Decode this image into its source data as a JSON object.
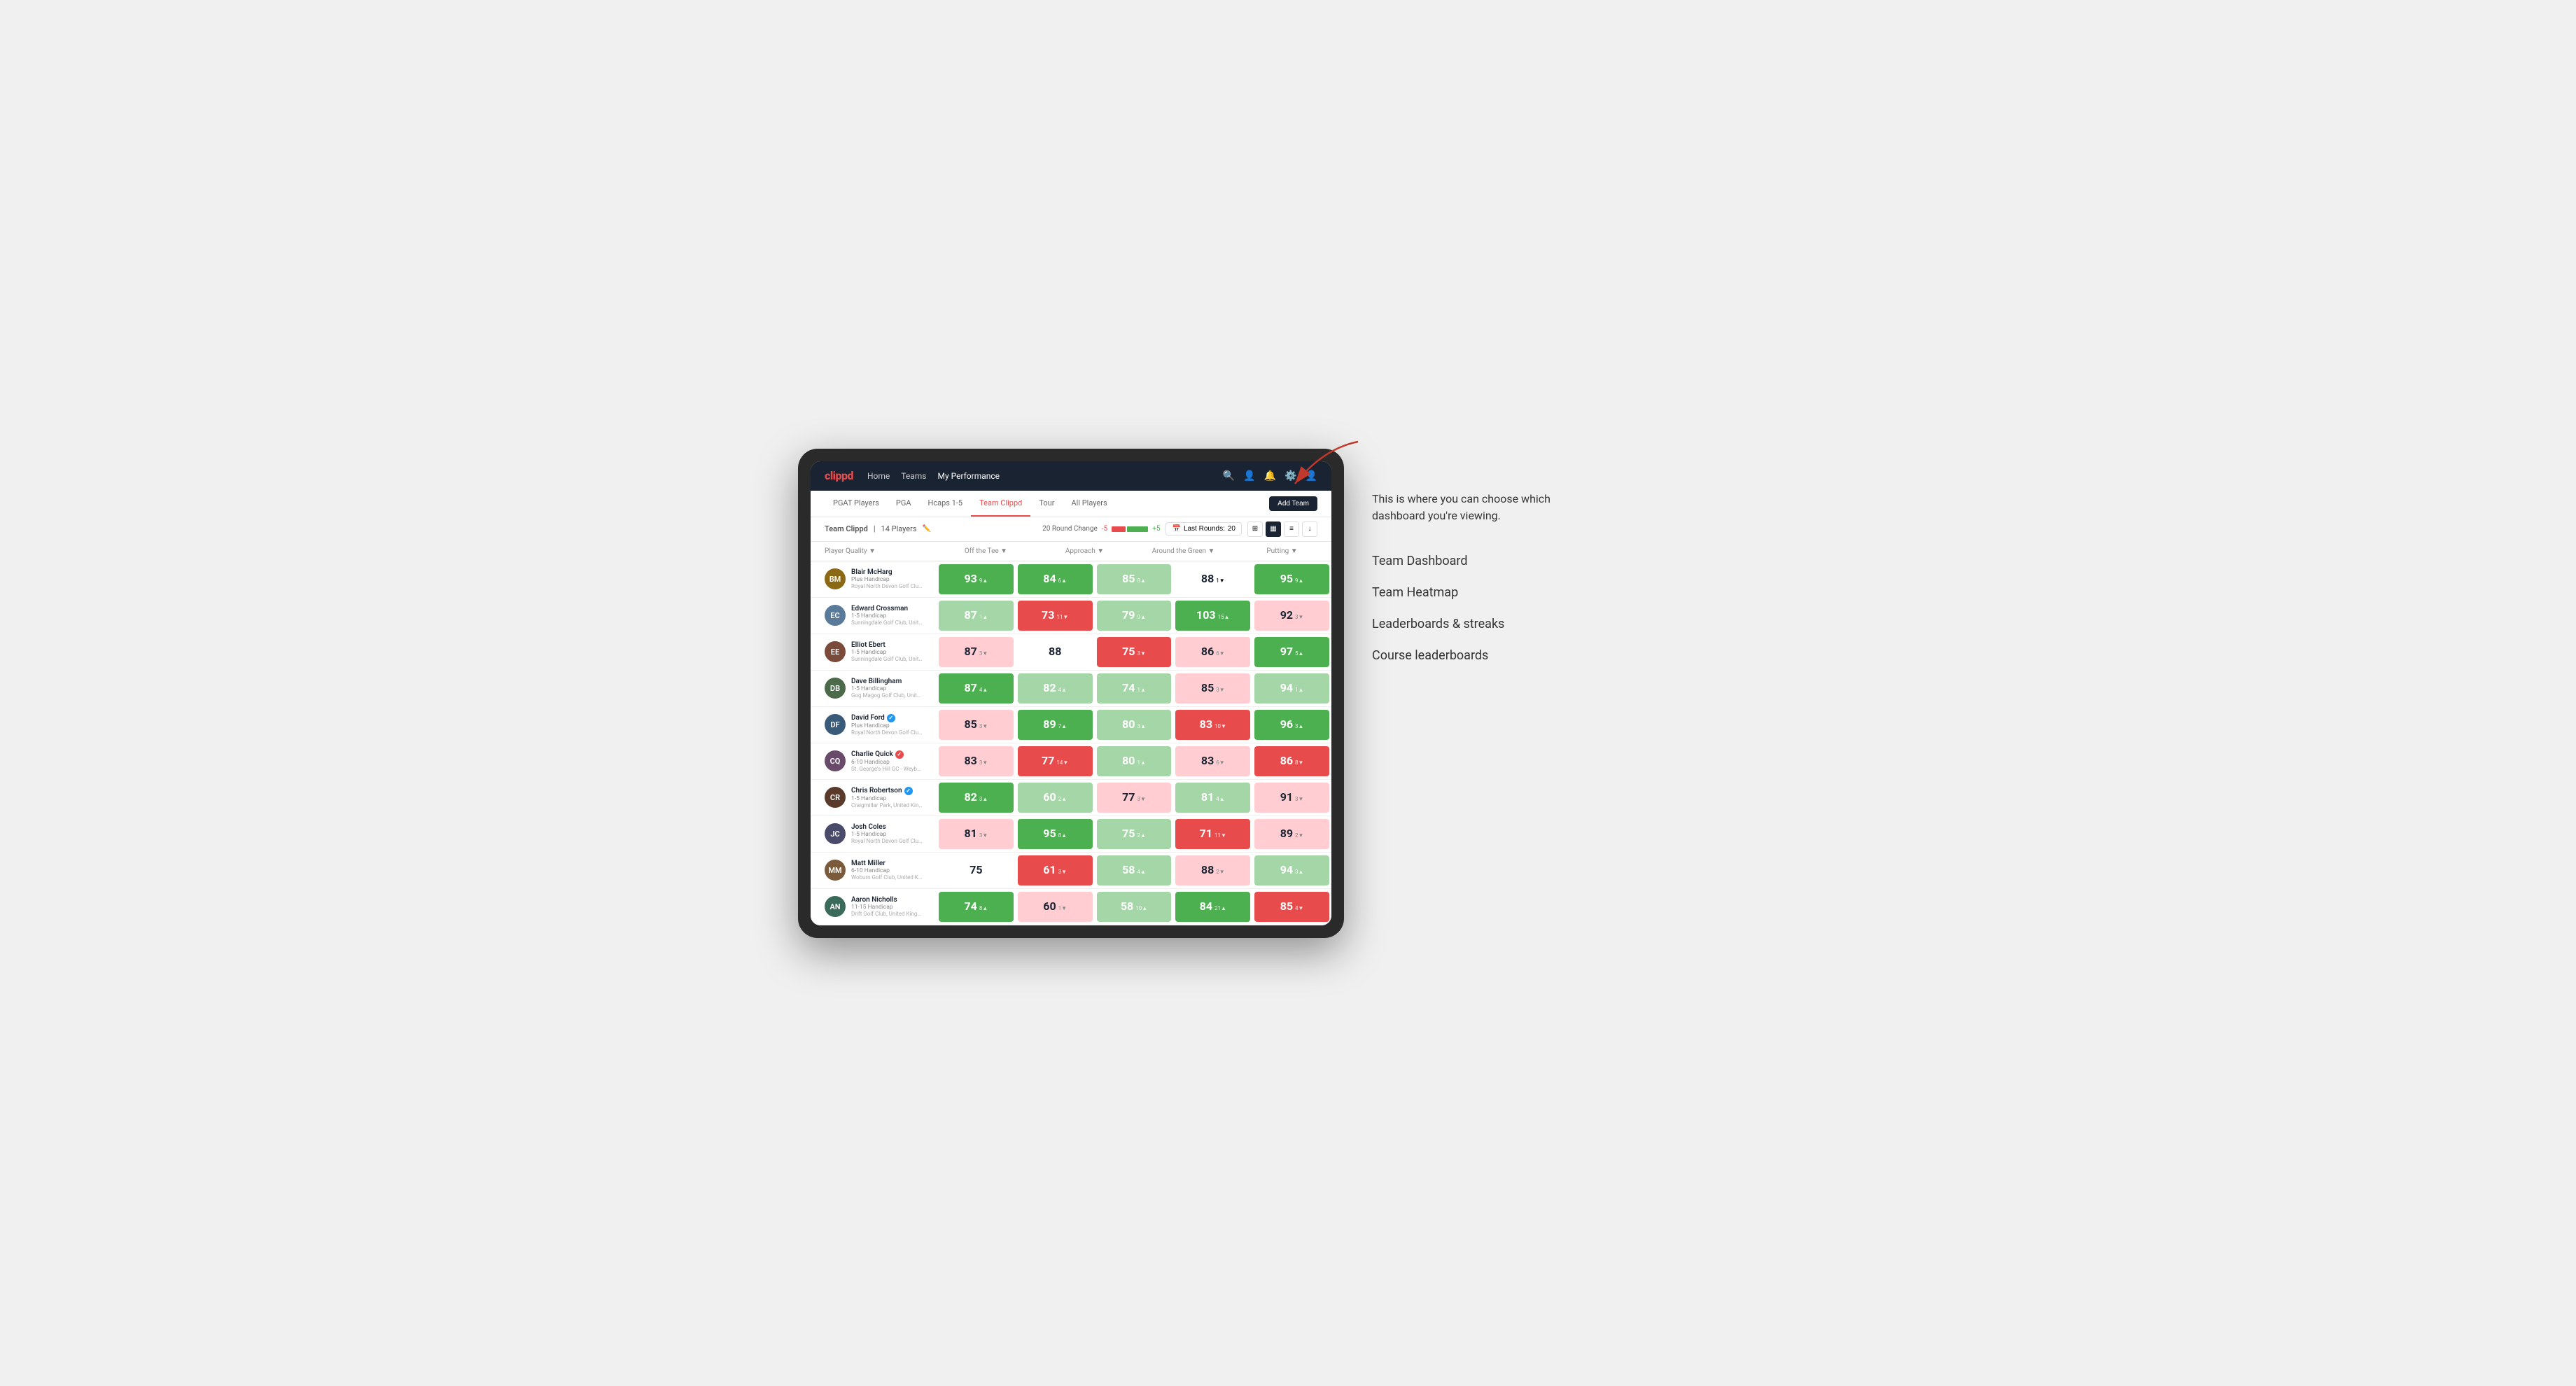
{
  "annotation": {
    "description": "This is where you can choose which dashboard you're viewing.",
    "items": [
      "Team Dashboard",
      "Team Heatmap",
      "Leaderboards & streaks",
      "Course leaderboards"
    ]
  },
  "nav": {
    "logo": "clippd",
    "links": [
      "Home",
      "Teams",
      "My Performance"
    ],
    "active_link": "My Performance"
  },
  "sub_nav": {
    "items": [
      "PGAT Players",
      "PGA",
      "Hcaps 1-5",
      "Team Clippd",
      "Tour",
      "All Players"
    ],
    "active_item": "Team Clippd",
    "add_team_label": "Add Team"
  },
  "team_header": {
    "title": "Team Clippd",
    "player_count": "14 Players",
    "round_change_label": "20 Round Change",
    "minus_label": "-5",
    "plus_label": "+5",
    "last_rounds_label": "Last Rounds:",
    "last_rounds_value": "20"
  },
  "columns": {
    "player_quality": "Player Quality ▼",
    "off_tee": "Off the Tee ▼",
    "approach": "Approach ▼",
    "around_green": "Around the Green ▼",
    "putting": "Putting ▼"
  },
  "players": [
    {
      "name": "Blair McHarg",
      "handicap": "Plus Handicap",
      "club": "Royal North Devon Golf Club, United Kingdom",
      "avatar_color": "#8B6914",
      "initials": "BM",
      "stats": {
        "player_quality": {
          "value": "93",
          "change": "9▲",
          "color": "green"
        },
        "off_tee": {
          "value": "84",
          "change": "6▲",
          "color": "green"
        },
        "approach": {
          "value": "85",
          "change": "8▲",
          "color": "light-green"
        },
        "around_green": {
          "value": "88",
          "change": "1▼",
          "color": "white"
        },
        "putting": {
          "value": "95",
          "change": "9▲",
          "color": "green"
        }
      }
    },
    {
      "name": "Edward Crossman",
      "handicap": "1-5 Handicap",
      "club": "Sunningdale Golf Club, United Kingdom",
      "avatar_color": "#5a7a9a",
      "initials": "EC",
      "stats": {
        "player_quality": {
          "value": "87",
          "change": "1▲",
          "color": "light-green"
        },
        "off_tee": {
          "value": "73",
          "change": "11▼",
          "color": "red"
        },
        "approach": {
          "value": "79",
          "change": "9▲",
          "color": "light-green"
        },
        "around_green": {
          "value": "103",
          "change": "15▲",
          "color": "green"
        },
        "putting": {
          "value": "92",
          "change": "3▼",
          "color": "light-red"
        }
      }
    },
    {
      "name": "Elliot Ebert",
      "handicap": "1-5 Handicap",
      "club": "Sunningdale Golf Club, United Kingdom",
      "avatar_color": "#7a4a3a",
      "initials": "EE",
      "stats": {
        "player_quality": {
          "value": "87",
          "change": "3▼",
          "color": "light-red"
        },
        "off_tee": {
          "value": "88",
          "change": "",
          "color": "white"
        },
        "approach": {
          "value": "75",
          "change": "3▼",
          "color": "red"
        },
        "around_green": {
          "value": "86",
          "change": "6▼",
          "color": "light-red"
        },
        "putting": {
          "value": "97",
          "change": "5▲",
          "color": "green"
        }
      }
    },
    {
      "name": "Dave Billingham",
      "handicap": "1-5 Handicap",
      "club": "Gog Magog Golf Club, United Kingdom",
      "avatar_color": "#4a6a4a",
      "initials": "DB",
      "stats": {
        "player_quality": {
          "value": "87",
          "change": "4▲",
          "color": "green"
        },
        "off_tee": {
          "value": "82",
          "change": "4▲",
          "color": "light-green"
        },
        "approach": {
          "value": "74",
          "change": "1▲",
          "color": "light-green"
        },
        "around_green": {
          "value": "85",
          "change": "3▼",
          "color": "light-red"
        },
        "putting": {
          "value": "94",
          "change": "1▲",
          "color": "light-green"
        }
      }
    },
    {
      "name": "David Ford",
      "handicap": "Plus Handicap",
      "club": "Royal North Devon Golf Club, United Kingdom",
      "avatar_color": "#3a5a7a",
      "initials": "DF",
      "badge": true,
      "badge_type": "blue",
      "stats": {
        "player_quality": {
          "value": "85",
          "change": "3▼",
          "color": "light-red"
        },
        "off_tee": {
          "value": "89",
          "change": "7▲",
          "color": "green"
        },
        "approach": {
          "value": "80",
          "change": "3▲",
          "color": "light-green"
        },
        "around_green": {
          "value": "83",
          "change": "10▼",
          "color": "red"
        },
        "putting": {
          "value": "96",
          "change": "3▲",
          "color": "green"
        }
      }
    },
    {
      "name": "Charlie Quick",
      "handicap": "6-10 Handicap",
      "club": "St. George's Hill GC - Weybridge - Surrey, Uni...",
      "avatar_color": "#6a4a6a",
      "initials": "CQ",
      "badge": true,
      "badge_type": "red",
      "stats": {
        "player_quality": {
          "value": "83",
          "change": "3▼",
          "color": "light-red"
        },
        "off_tee": {
          "value": "77",
          "change": "14▼",
          "color": "red"
        },
        "approach": {
          "value": "80",
          "change": "1▲",
          "color": "light-green"
        },
        "around_green": {
          "value": "83",
          "change": "6▼",
          "color": "light-red"
        },
        "putting": {
          "value": "86",
          "change": "8▼",
          "color": "red"
        }
      }
    },
    {
      "name": "Chris Robertson",
      "handicap": "1-5 Handicap",
      "club": "Craigmillar Park, United Kingdom",
      "avatar_color": "#5a3a2a",
      "initials": "CR",
      "badge": true,
      "badge_type": "blue",
      "stats": {
        "player_quality": {
          "value": "82",
          "change": "3▲",
          "color": "green"
        },
        "off_tee": {
          "value": "60",
          "change": "2▲",
          "color": "light-green"
        },
        "approach": {
          "value": "77",
          "change": "3▼",
          "color": "light-red"
        },
        "around_green": {
          "value": "81",
          "change": "4▲",
          "color": "light-green"
        },
        "putting": {
          "value": "91",
          "change": "3▼",
          "color": "light-red"
        }
      }
    },
    {
      "name": "Josh Coles",
      "handicap": "1-5 Handicap",
      "club": "Royal North Devon Golf Club, United Kingdom",
      "avatar_color": "#4a4a6a",
      "initials": "JC",
      "stats": {
        "player_quality": {
          "value": "81",
          "change": "3▼",
          "color": "light-red"
        },
        "off_tee": {
          "value": "95",
          "change": "8▲",
          "color": "green"
        },
        "approach": {
          "value": "75",
          "change": "2▲",
          "color": "light-green"
        },
        "around_green": {
          "value": "71",
          "change": "11▼",
          "color": "red"
        },
        "putting": {
          "value": "89",
          "change": "2▼",
          "color": "light-red"
        }
      }
    },
    {
      "name": "Matt Miller",
      "handicap": "6-10 Handicap",
      "club": "Woburn Golf Club, United Kingdom",
      "avatar_color": "#7a5a3a",
      "initials": "MM",
      "stats": {
        "player_quality": {
          "value": "75",
          "change": "",
          "color": "white"
        },
        "off_tee": {
          "value": "61",
          "change": "3▼",
          "color": "red"
        },
        "approach": {
          "value": "58",
          "change": "4▲",
          "color": "light-green"
        },
        "around_green": {
          "value": "88",
          "change": "2▼",
          "color": "light-red"
        },
        "putting": {
          "value": "94",
          "change": "3▲",
          "color": "light-green"
        }
      }
    },
    {
      "name": "Aaron Nicholls",
      "handicap": "11-15 Handicap",
      "club": "Drift Golf Club, United Kingdom",
      "avatar_color": "#3a6a5a",
      "initials": "AN",
      "stats": {
        "player_quality": {
          "value": "74",
          "change": "8▲",
          "color": "green"
        },
        "off_tee": {
          "value": "60",
          "change": "1▼",
          "color": "light-red"
        },
        "approach": {
          "value": "58",
          "change": "10▲",
          "color": "light-green"
        },
        "around_green": {
          "value": "84",
          "change": "21▲",
          "color": "green"
        },
        "putting": {
          "value": "85",
          "change": "4▼",
          "color": "red"
        }
      }
    }
  ]
}
